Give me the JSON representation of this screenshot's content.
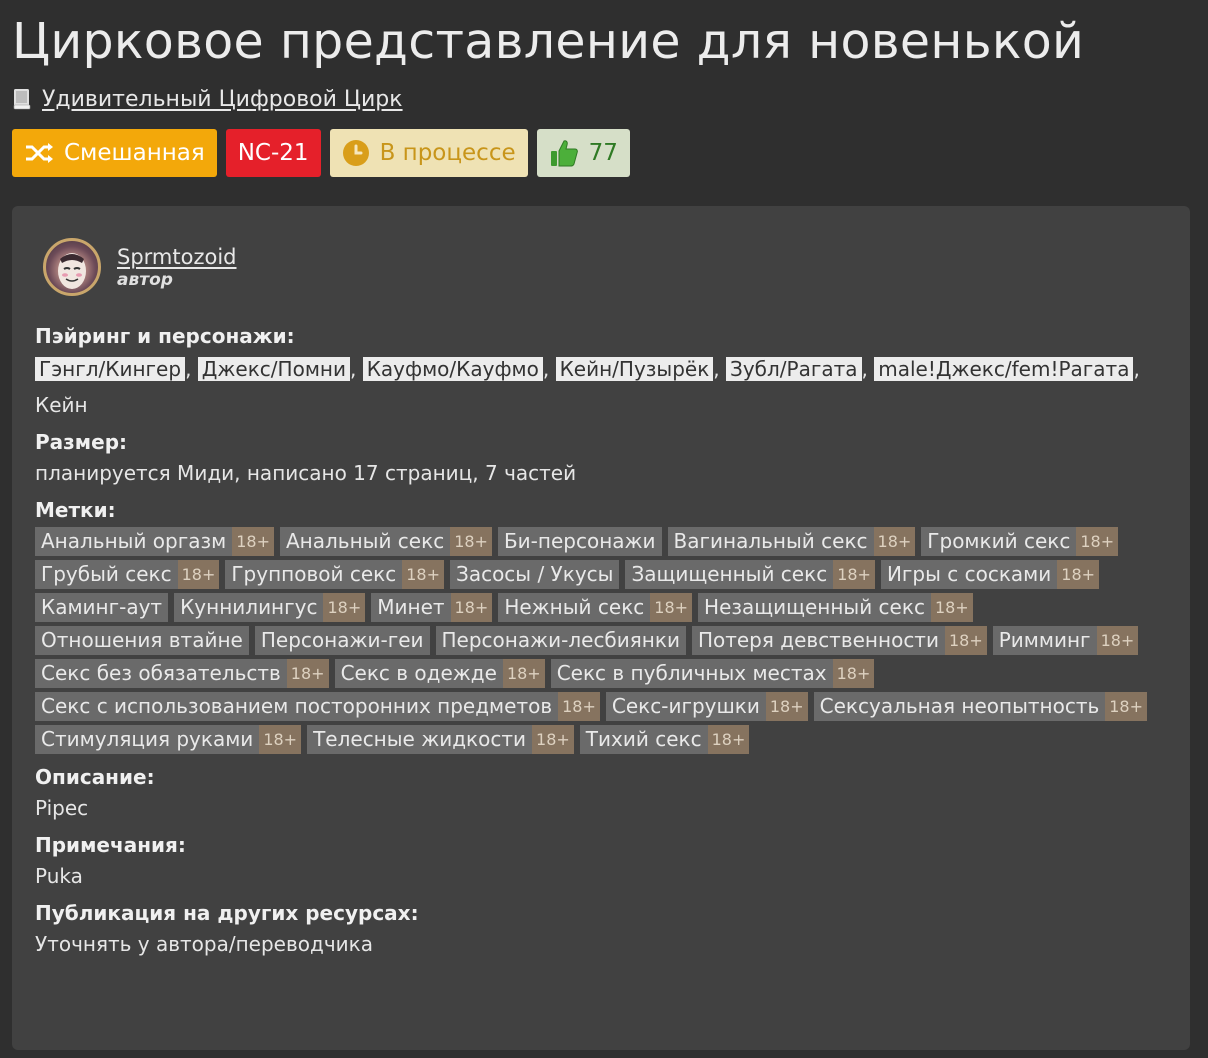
{
  "title": "Цирковое представление для новенькой",
  "fandom": {
    "icon": "book-icon",
    "name": "Удивительный Цифровой Цирк"
  },
  "badges": {
    "direction": {
      "icon": "shuffle-icon",
      "label": "Смешанная",
      "color": "#f3a80a"
    },
    "rating": {
      "label": "NC-21",
      "color": "#e5202a"
    },
    "status": {
      "icon": "clock-icon",
      "label": "В процессе",
      "color": "#efe2b4"
    },
    "likes": {
      "icon": "thumbs-up-icon",
      "count": "77",
      "color": "#d6dfc8"
    }
  },
  "author": {
    "name": "Sprmtozoid",
    "role": "автор"
  },
  "sections": {
    "pairings_heading": "Пэйринг и персонажи:",
    "pairings": [
      "Гэнгл/Кингер",
      "Джекс/Помни",
      "Кауфмо/Кауфмо",
      "Кейн/Пузырёк",
      "Зубл/Рагата",
      "male!Джекс/fem!Рагата"
    ],
    "characters": ", Кейн",
    "size_heading": "Размер:",
    "size_text": "планируется Миди, написано 17 страниц, 7 частей",
    "tags_heading": "Метки:",
    "tags": [
      {
        "name": "Анальный оргазм",
        "age": "18+"
      },
      {
        "name": "Анальный секс",
        "age": "18+"
      },
      {
        "name": "Би-персонажи",
        "age": ""
      },
      {
        "name": "Вагинальный секс",
        "age": "18+"
      },
      {
        "name": "Громкий секс",
        "age": "18+"
      },
      {
        "name": "Грубый секс",
        "age": "18+"
      },
      {
        "name": "Групповой секс",
        "age": "18+"
      },
      {
        "name": "Засосы / Укусы",
        "age": ""
      },
      {
        "name": "Защищенный секс",
        "age": "18+"
      },
      {
        "name": "Игры с сосками",
        "age": "18+"
      },
      {
        "name": "Каминг-аут",
        "age": ""
      },
      {
        "name": "Куннилингус",
        "age": "18+"
      },
      {
        "name": "Минет",
        "age": "18+"
      },
      {
        "name": "Нежный секс",
        "age": "18+"
      },
      {
        "name": "Незащищенный секс",
        "age": "18+"
      },
      {
        "name": "Отношения втайне",
        "age": ""
      },
      {
        "name": "Персонажи-геи",
        "age": ""
      },
      {
        "name": "Персонажи-лесбиянки",
        "age": ""
      },
      {
        "name": "Потеря девственности",
        "age": "18+"
      },
      {
        "name": "Римминг",
        "age": "18+"
      },
      {
        "name": "Секс без обязательств",
        "age": "18+"
      },
      {
        "name": "Секс в одежде",
        "age": "18+"
      },
      {
        "name": "Секс в публичных местах",
        "age": "18+"
      },
      {
        "name": "Секс с использованием посторонних предметов",
        "age": "18+"
      },
      {
        "name": "Секс-игрушки",
        "age": "18+"
      },
      {
        "name": "Сексуальная неопытность",
        "age": "18+"
      },
      {
        "name": "Стимуляция руками",
        "age": "18+"
      },
      {
        "name": "Телесные жидкости",
        "age": "18+"
      },
      {
        "name": "Тихий секс",
        "age": "18+"
      }
    ],
    "description_heading": "Описание:",
    "description_text": "Pipec",
    "notes_heading": "Примечания:",
    "notes_text": "Puka",
    "publication_heading": "Публикация на других ресурсах:",
    "publication_text": "Уточнять у автора/переводчика"
  }
}
